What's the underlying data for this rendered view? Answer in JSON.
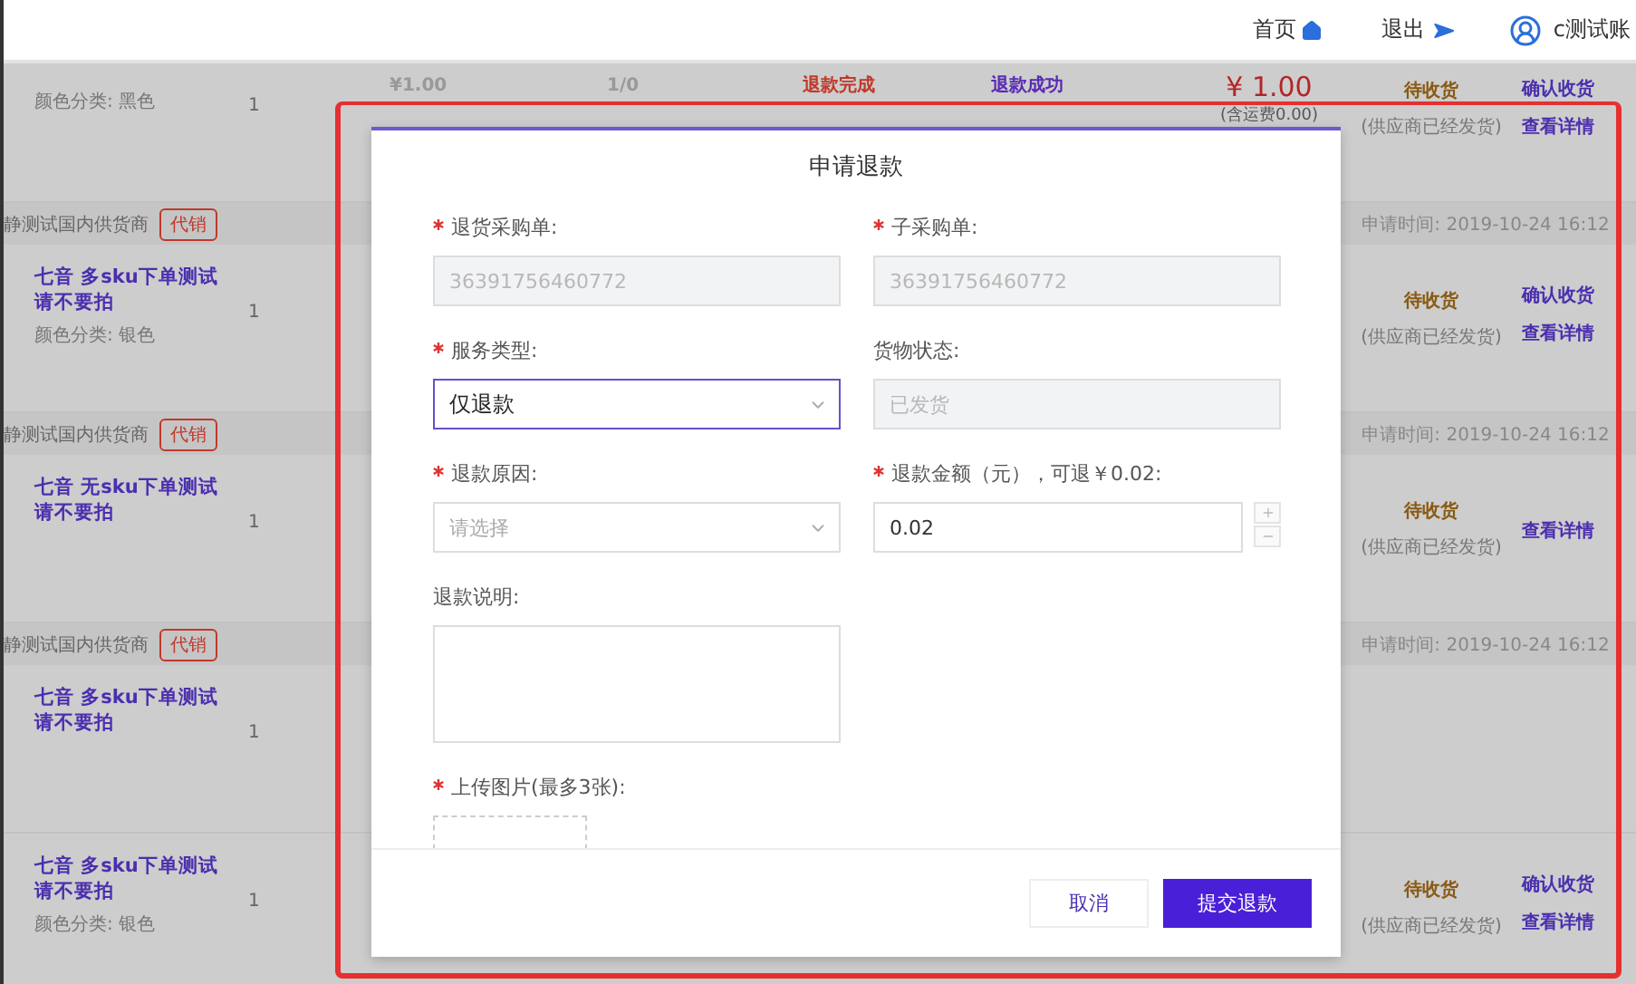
{
  "header": {
    "links": [
      {
        "label": "首页"
      },
      {
        "label": "退出"
      }
    ],
    "user": "c测试账"
  },
  "orders": [
    {
      "kind": "item",
      "color_spec": "颜色分类: 黑色",
      "qty": "1",
      "unit_price": "¥1.00",
      "ratio": "1/0",
      "refund_status": "退款完成",
      "refund_result": "退款成功",
      "total": "¥ 1.00",
      "shipping": "(含运费0.00)",
      "status": "待收货",
      "status_note": "(供应商已经发货)",
      "actions": [
        "确认收货",
        "查看详情"
      ]
    },
    {
      "kind": "group",
      "supplier": "静测试国内供货商",
      "tag": "代销",
      "time": "申请时间: 2019-10-24 16:12"
    },
    {
      "kind": "item",
      "title_lines": [
        "七音 多sku下单测试",
        "请不要拍"
      ],
      "color_spec": "颜色分类: 银色",
      "qty": "1",
      "status": "待收货",
      "status_note": "(供应商已经发货)",
      "actions": [
        "确认收货",
        "查看详情"
      ]
    },
    {
      "kind": "group",
      "supplier": "静测试国内供货商",
      "tag": "代销",
      "time": "申请时间: 2019-10-24 16:12"
    },
    {
      "kind": "item",
      "title_lines": [
        "七音 无sku下单测试",
        "请不要拍"
      ],
      "qty": "1",
      "status": "待收货",
      "status_note": "(供应商已经发货)",
      "actions": [
        "查看详情"
      ]
    },
    {
      "kind": "group",
      "supplier": "静测试国内供货商",
      "tag": "代销",
      "time": "申请时间: 2019-10-24 16:12"
    },
    {
      "kind": "item",
      "title_lines": [
        "七音 多sku下单测试",
        "请不要拍"
      ],
      "qty": "1"
    },
    {
      "kind": "item",
      "title_lines": [
        "七音 多sku下单测试",
        "请不要拍"
      ],
      "color_spec": "颜色分类: 银色",
      "qty": "1",
      "status": "待收货",
      "status_note": "(供应商已经发货)",
      "actions": [
        "确认收货",
        "查看详情"
      ]
    }
  ],
  "dialog": {
    "title": "申请退款",
    "rows": [
      [
        {
          "kind": "text",
          "label": "退货采购单:",
          "required": true,
          "value": "36391756460772",
          "disabled": true
        },
        {
          "kind": "text",
          "label": "子采购单:",
          "required": true,
          "value": "36391756460772",
          "disabled": true
        }
      ],
      [
        {
          "kind": "select",
          "label": "服务类型:",
          "required": true,
          "value": "仅退款",
          "focused": true
        },
        {
          "kind": "text",
          "label": "货物状态:",
          "required": false,
          "value": "已发货",
          "disabled": true
        }
      ],
      [
        {
          "kind": "select",
          "label": "退款原因:",
          "required": true,
          "placeholder": "请选择",
          "focused": false
        },
        {
          "kind": "number",
          "label": "退款金额（元），可退￥0.02:",
          "required": true,
          "value": "0.02"
        }
      ],
      [
        {
          "kind": "textarea",
          "label": "退款说明:",
          "required": false
        }
      ],
      [
        {
          "kind": "upload",
          "label": "上传图片(最多3张):",
          "required": true
        }
      ]
    ],
    "buttons": [
      {
        "label": "取消",
        "kind": "secondary"
      },
      {
        "label": "提交退款",
        "kind": "primary"
      }
    ]
  }
}
